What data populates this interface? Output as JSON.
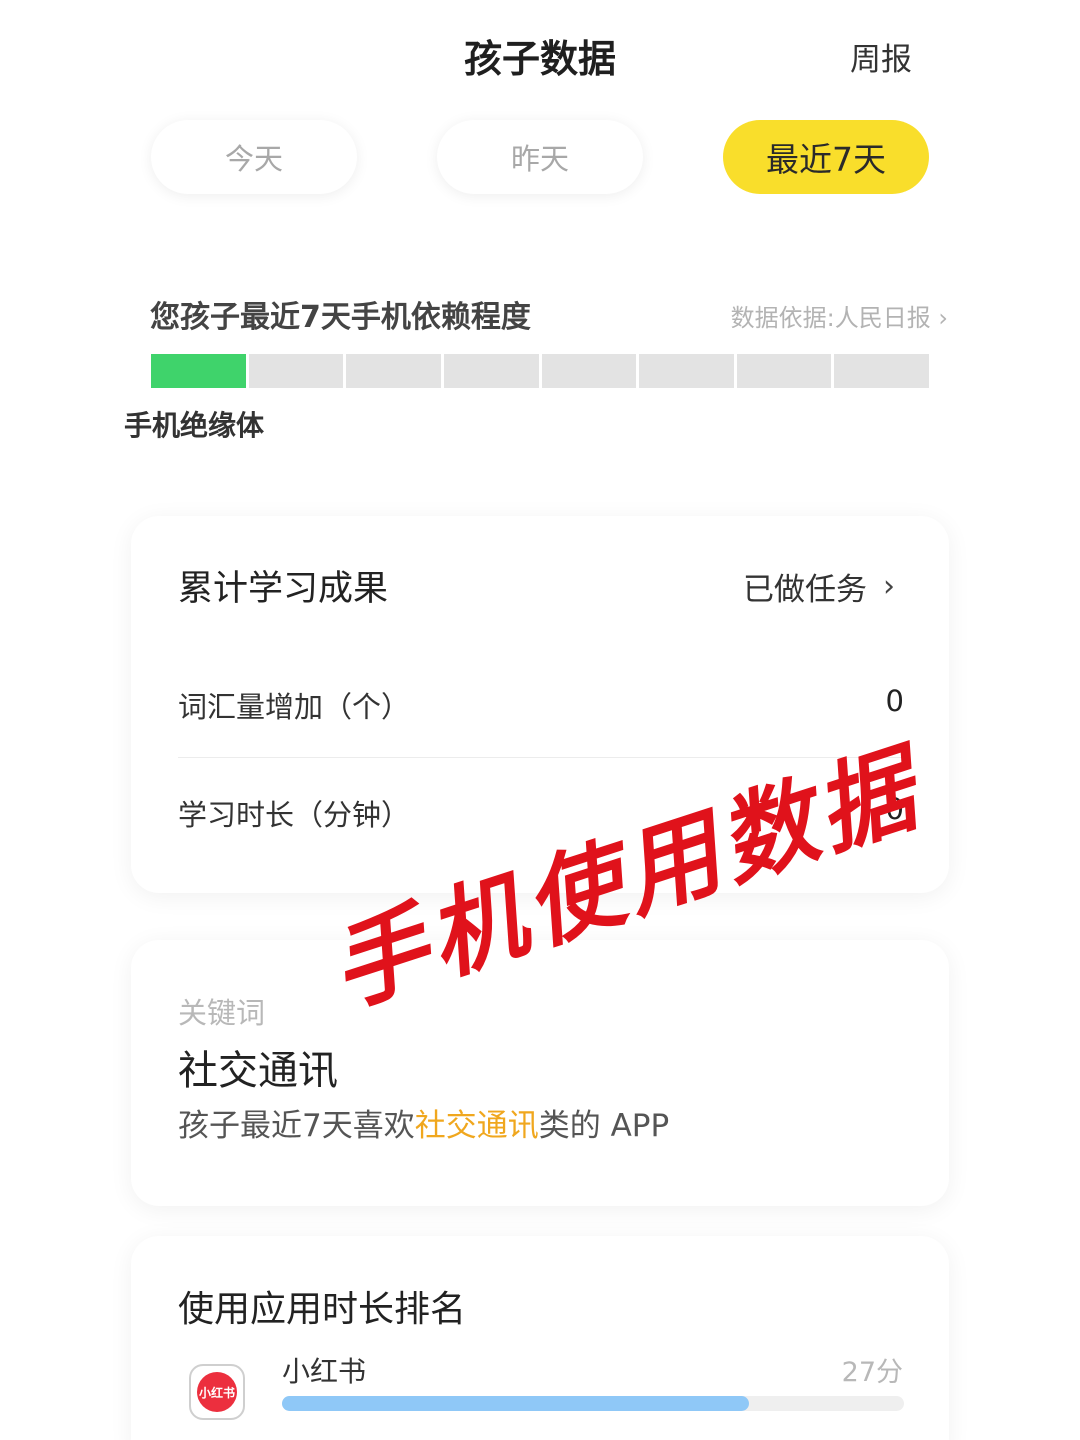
{
  "header": {
    "title": "孩子数据",
    "weekly_label": "周报"
  },
  "tabs": [
    {
      "label": "今天",
      "active": false
    },
    {
      "label": "昨天",
      "active": false
    },
    {
      "label": "最近7天",
      "active": true
    }
  ],
  "dependency": {
    "title": "您孩子最近7天手机依赖程度",
    "source_label": "数据依据:人民日报",
    "source_chevron": "›",
    "level_label": "手机绝缘体",
    "level": 1,
    "level_total": 8,
    "active_color": "#3fd36b"
  },
  "learning": {
    "title": "累计学习成果",
    "link_label": "已做任务",
    "link_chevron": "›",
    "rows": [
      {
        "label": "词汇量增加（个）",
        "value": "0"
      },
      {
        "label": "学习时长（分钟）",
        "value": "0"
      }
    ]
  },
  "keyword": {
    "label": "关键词",
    "word": "社交通讯",
    "desc_prefix": "孩子最近7天喜欢",
    "desc_highlight": "社交通讯",
    "desc_suffix": "类的 APP",
    "highlight_color": "#f0a71e"
  },
  "ranking": {
    "title": "使用应用时长排名",
    "apps": [
      {
        "name": "小红书",
        "time": "27分",
        "icon_text": "小红书",
        "usage_fraction": 0.75
      }
    ]
  },
  "watermark": {
    "text": "手机使用数据",
    "color": "#e0121b"
  }
}
